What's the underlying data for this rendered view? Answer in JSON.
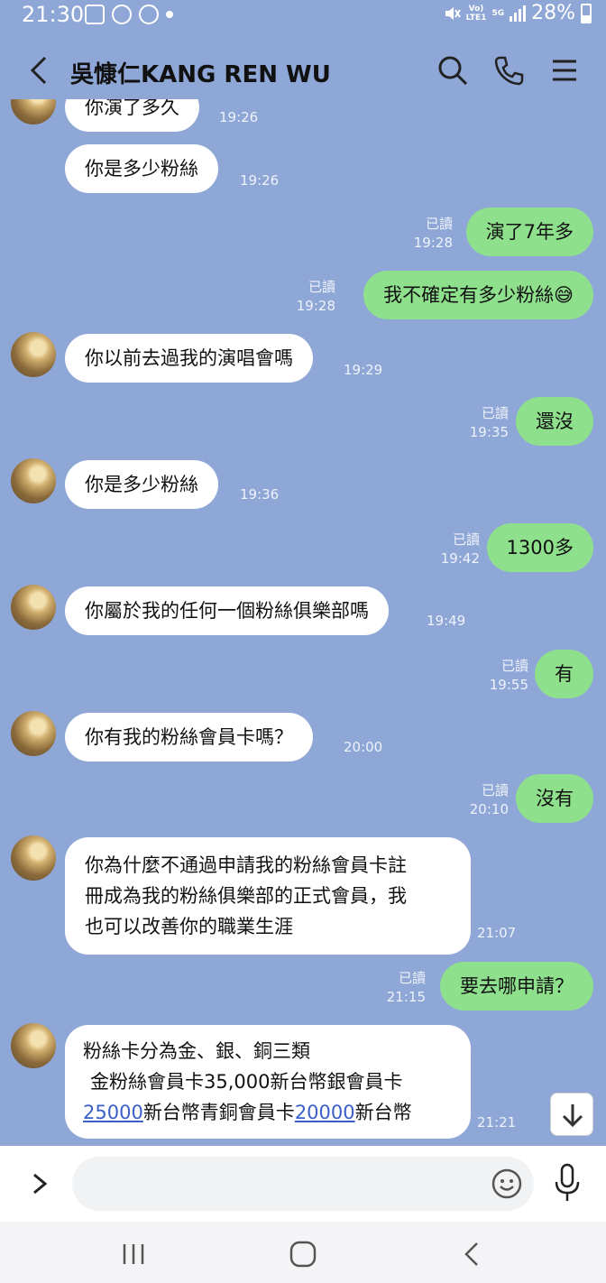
{
  "status_bar": {
    "time": "21:30",
    "net_top": "Vo)",
    "net_bottom": "LTE1",
    "net_type": "5G",
    "battery": "28%",
    "icons": [
      "gallery-icon",
      "chrome-icon",
      "messenger-icon",
      "dot-icon",
      "mute-icon",
      "signal-icon",
      "battery-icon"
    ]
  },
  "header": {
    "title": "吳慷仁KANG REN WU",
    "icons": [
      "back-icon",
      "search-icon",
      "phone-icon",
      "menu-icon"
    ]
  },
  "messages": [
    {
      "side": "in",
      "text": "你演了多久",
      "time": "19:26"
    },
    {
      "side": "in",
      "text": "你是多少粉絲",
      "time": "19:26"
    },
    {
      "side": "out",
      "text": "演了7年多",
      "read": "已讀",
      "time": "19:28"
    },
    {
      "side": "out",
      "text": "我不確定有多少粉絲😅",
      "read": "已讀",
      "time": "19:28"
    },
    {
      "side": "in",
      "text": "你以前去過我的演唱會嗎",
      "time": "19:29"
    },
    {
      "side": "out",
      "text": "還沒",
      "read": "已讀",
      "time": "19:35"
    },
    {
      "side": "in",
      "text": "你是多少粉絲",
      "time": "19:36"
    },
    {
      "side": "out",
      "text": "1300多",
      "read": "已讀",
      "time": "19:42"
    },
    {
      "side": "in",
      "text": "你屬於我的任何一個粉絲俱樂部嗎",
      "time": "19:49"
    },
    {
      "side": "out",
      "text": "有",
      "read": "已讀",
      "time": "19:55"
    },
    {
      "side": "in",
      "text": "你有我的粉絲會員卡嗎？",
      "time": "20:00"
    },
    {
      "side": "out",
      "text": "沒有",
      "read": "已讀",
      "time": "20:10"
    },
    {
      "side": "in",
      "lines": [
        "你為什麼不通過申請我的粉絲會員卡註",
        "冊成為我的粉絲俱樂部的正式會員，我",
        "也可以改善你的職業生涯"
      ],
      "time": "21:07"
    },
    {
      "side": "out",
      "text": "要去哪申請？",
      "read": "已讀",
      "time": "21:15"
    },
    {
      "side": "in",
      "line1": "粉絲卡分為金、銀、銅三類",
      "line2": "金粉絲會員卡35,000新台幣銀會員卡",
      "line3_link1": "25000",
      "line3_mid": "新台幣青銅會員卡",
      "line3_link2": "20000",
      "line3_end": "新台幣",
      "time": "21:21"
    }
  ],
  "input": {
    "placeholder": "",
    "icons": [
      "expand-icon",
      "emoji-icon",
      "mic-icon",
      "scroll-down-icon"
    ]
  },
  "navbar": {
    "icons": [
      "recent-apps-icon",
      "home-icon",
      "nav-back-icon"
    ]
  },
  "colors": {
    "background": "#8fa7d6",
    "outgoing_bubble": "#8ee08c",
    "incoming_bubble": "#ffffff",
    "link": "#3a60c8"
  }
}
